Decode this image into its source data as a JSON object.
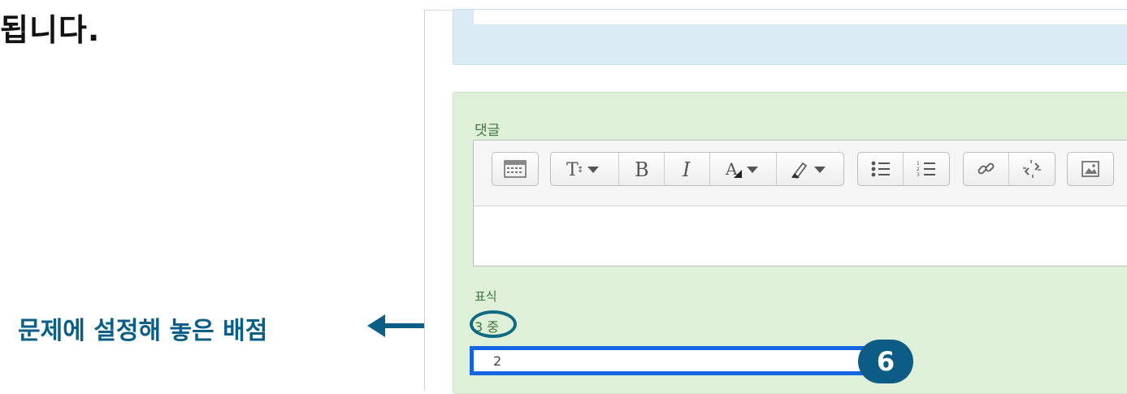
{
  "heading_fragment": "됩니다.",
  "callout": {
    "label": "문제에 설정해 놓은 배점",
    "color": "#0b5e86"
  },
  "form": {
    "comment_label": "댓글",
    "toolbar": [
      {
        "group": "collapse",
        "buttons": [
          "show-more-icon"
        ]
      },
      {
        "group": "style",
        "buttons": [
          "paragraph-style-icon",
          "bold-icon",
          "italic-icon",
          "font-color-icon",
          "background-color-icon"
        ]
      },
      {
        "group": "list",
        "buttons": [
          "unordered-list-icon",
          "ordered-list-icon"
        ]
      },
      {
        "group": "link",
        "buttons": [
          "link-icon",
          "unlink-icon"
        ]
      },
      {
        "group": "media",
        "buttons": [
          "image-icon"
        ]
      }
    ],
    "grade_label": "표식",
    "grade_max_text": "3 중",
    "grade_value": "2"
  },
  "step_badge": "6",
  "colors": {
    "info_panel": "#daebf5",
    "form_panel": "#dff0d8",
    "label_green": "#3c763d",
    "highlight_blue": "#1565e0",
    "badge": "#0d5c86"
  }
}
